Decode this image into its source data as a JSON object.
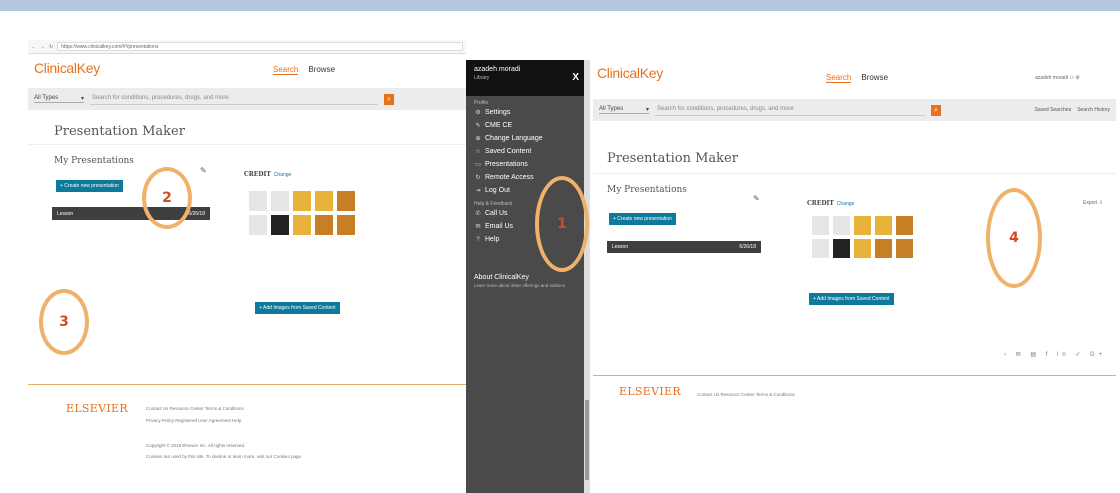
{
  "left": {
    "url": "https://www.clinicalkey.com/#!/presentations",
    "logo": "ClinicalKey",
    "nav": {
      "search": "Search",
      "browse": "Browse"
    },
    "search": {
      "types": "All Types",
      "caret": "▾",
      "placeholder": "Search for conditions, procedures, drugs, and more"
    },
    "title": "Presentation Maker",
    "my_pres": "My Presentations",
    "create_btn": "+ Create new presentation",
    "row": {
      "name": "Lesson",
      "date": "6/26/18"
    },
    "credit": "CREDIT",
    "change": "Change",
    "add_images": "+ Add Images from Saved Content",
    "elsevier": "ELSEVIER",
    "footer_links1": "Contact Us   Resource Center   Terms & Conditions",
    "footer_links2": "Privacy Policy   Registered User Agreement   Help",
    "copyright": "Copyright © 2018 Elsevier Inc. All rights reserved.",
    "cookies": "Cookies are used by this site. To decline or learn more, visit our Cookies page"
  },
  "menu": {
    "user": "azadeh moradi",
    "library": "Library",
    "close": "X",
    "profile": "Profile",
    "items": [
      {
        "icon": "⚙",
        "label": "Settings"
      },
      {
        "icon": "✎",
        "label": "CME CE"
      },
      {
        "icon": "⊕",
        "label": "Change Language"
      },
      {
        "icon": "☆",
        "label": "Saved Content"
      },
      {
        "icon": "▭",
        "label": "Presentations"
      },
      {
        "icon": "↻",
        "label": "Remote Access"
      },
      {
        "icon": "⇥",
        "label": "Log Out"
      }
    ],
    "help_sec": "Help & Feedback",
    "help_items": [
      {
        "icon": "✆",
        "label": "Call Us"
      },
      {
        "icon": "✉",
        "label": "Email Us"
      },
      {
        "icon": "?",
        "label": "Help"
      }
    ],
    "about": "About ClinicalKey",
    "about_desc": "Learn more about other offerings and editions"
  },
  "right": {
    "logo": "ClinicalKey",
    "nav": {
      "search": "Search",
      "browse": "Browse"
    },
    "user": "azadeh moradi",
    "search": {
      "types": "All Types",
      "caret": "▾",
      "placeholder": "Search for conditions, procedures, drugs, and more",
      "saved": "Saved Searches",
      "history": "Search History"
    },
    "title": "Presentation Maker",
    "my_pres": "My Presentations",
    "create_btn": "+ Create new presentation",
    "row": {
      "name": "Lesson",
      "date": "6/26/18"
    },
    "credit": "CREDIT",
    "change": "Change",
    "export": "Export",
    "add_images": "+ Add Images from Saved Content",
    "share": "‹  ✉  ▤  f  in  ✓  G+",
    "elsevier": "ELSEVIER",
    "footer_links": "Contact Us   Resource Center   Terms & Conditions"
  },
  "callouts": [
    "1",
    "2",
    "3",
    "4"
  ],
  "colors": {
    "accent": "#e9711c",
    "teal": "#0e7a9b",
    "callout": "#f0b16b",
    "menu": "#4a4a4a"
  }
}
